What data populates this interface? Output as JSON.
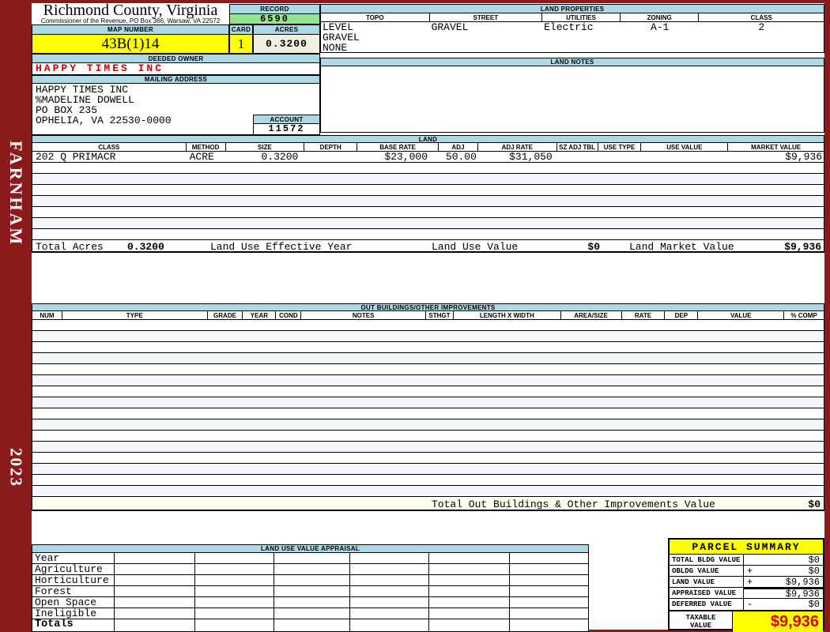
{
  "header": {
    "title": "Richmond County, Virginia",
    "subtitle": "Commissioner of the Revenue, PO Box 366, Warsaw, VA 22572"
  },
  "sidebar": {
    "district": "FARNHAM",
    "year": "2023"
  },
  "record": {
    "label": "RECORD",
    "value": "6590"
  },
  "map": {
    "label": "MAP NUMBER",
    "value": "43B(1)14"
  },
  "card": {
    "label": "CARD",
    "value": "1"
  },
  "acres": {
    "label": "ACRES",
    "value": "0.3200"
  },
  "owner": {
    "label": "DEEDED OWNER",
    "value": "HAPPY TIMES INC"
  },
  "mailing": {
    "label": "MAILING ADDRESS",
    "lines": [
      "HAPPY TIMES INC",
      "%MADELINE DOWELL",
      "PO BOX 235",
      "OPHELIA, VA 22530-0000"
    ]
  },
  "account": {
    "label": "ACCOUNT",
    "value": "11572"
  },
  "land_properties": {
    "title": "LAND PROPERTIES",
    "columns": [
      "TOPO",
      "STREET",
      "UTILITIES",
      "ZONING",
      "CLASS"
    ],
    "rows": [
      [
        "LEVEL",
        "GRAVEL",
        "Electric",
        "A-1",
        "2"
      ],
      [
        "GRAVEL",
        "",
        "",
        "",
        ""
      ],
      [
        "NONE",
        "",
        "",
        "",
        ""
      ]
    ]
  },
  "land_notes": {
    "title": "LAND NOTES",
    "content": ""
  },
  "land": {
    "title": "LAND",
    "columns": [
      "CLASS",
      "METHOD",
      "SIZE",
      "DEPTH",
      "BASE RATE",
      "ADJ",
      "ADJ RATE",
      "SZ ADJ TBL",
      "USE TYPE",
      "USE VALUE",
      "MARKET VALUE"
    ],
    "rows": [
      [
        "202 Q PRIMACR",
        "ACRE",
        "0.3200",
        "",
        "$23,000",
        "50.00",
        "$31,050",
        "",
        "",
        "",
        "$9,936"
      ]
    ],
    "empty_row_count": 7,
    "totals": {
      "total_acres_label": "Total Acres",
      "total_acres": "0.3200",
      "effective_year_label": "Land Use Effective Year",
      "use_value_label": "Land Use Value",
      "use_value": "$0",
      "market_value_label": "Land Market Value",
      "market_value": "$9,936"
    }
  },
  "out_buildings": {
    "title": "OUT BUILDINGS/OTHER IMPROVEMENTS",
    "columns": [
      "NUM",
      "TYPE",
      "GRADE",
      "YEAR",
      "COND",
      "NOTES",
      "STHGT",
      "LENGTH X WIDTH",
      "AREA/SIZE",
      "RATE",
      "DEP",
      "VALUE",
      "% COMP"
    ],
    "empty_row_count": 16,
    "total_label": "Total Out Buildings & Other Improvements Value",
    "total_value": "$0"
  },
  "appraisal": {
    "title": "LAND USE VALUE APPRAISAL",
    "row_labels": [
      "Year",
      "Agriculture",
      "Horticulture",
      "Forest",
      "Open Space",
      "Ineligible",
      "Totals"
    ],
    "column_count": 6
  },
  "parcel": {
    "title": "PARCEL SUMMARY",
    "rows": [
      {
        "label": "TOTAL BLDG VALUE",
        "sign": "",
        "value": "$0"
      },
      {
        "label": "OBLDG VALUE",
        "sign": "+",
        "value": "$0"
      },
      {
        "label": "LAND VALUE",
        "sign": "+",
        "value": "$9,936"
      },
      {
        "label": "APPRAISED VALUE",
        "sign": "",
        "value": "$9,936"
      },
      {
        "label": "DEFERRED VALUE",
        "sign": "-",
        "value": "$0"
      }
    ],
    "taxable": {
      "label": "TAXABLE VALUE",
      "value": "$9,936"
    }
  },
  "colors": {
    "frame_maroon": "#8B1A1A",
    "header_blue": "#ADD8E6",
    "record_green": "#94E494",
    "highlight_yellow": "#FFFF00",
    "acres_cream": "#F0EEDF",
    "owner_red": "#CC0000",
    "taxable_red": "#DD0000"
  }
}
